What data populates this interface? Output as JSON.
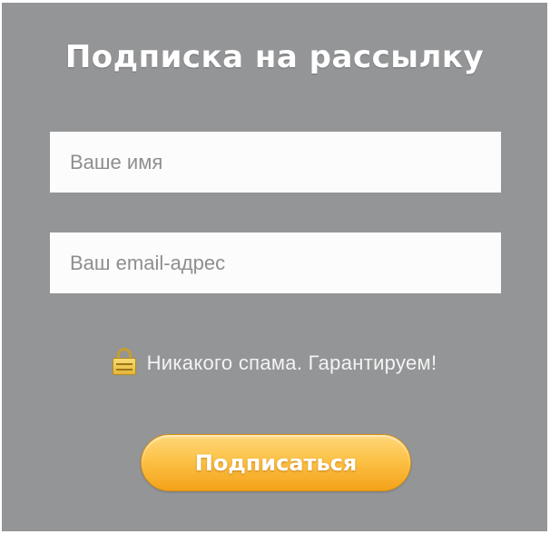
{
  "form": {
    "title": "Подписка на рассылку",
    "name_field": {
      "placeholder": "Ваше имя",
      "value": ""
    },
    "email_field": {
      "placeholder": "Ваш email-адрес",
      "value": ""
    },
    "note": {
      "icon": "lock-icon",
      "text": "Никакого спама. Гарантируем!"
    },
    "submit_label": "Подписаться"
  },
  "colors": {
    "panel_background": "#949597",
    "button_gradient_top": "#ffd77a",
    "button_gradient_bottom": "#f4a21a",
    "lock_icon": "#e8bd45"
  }
}
